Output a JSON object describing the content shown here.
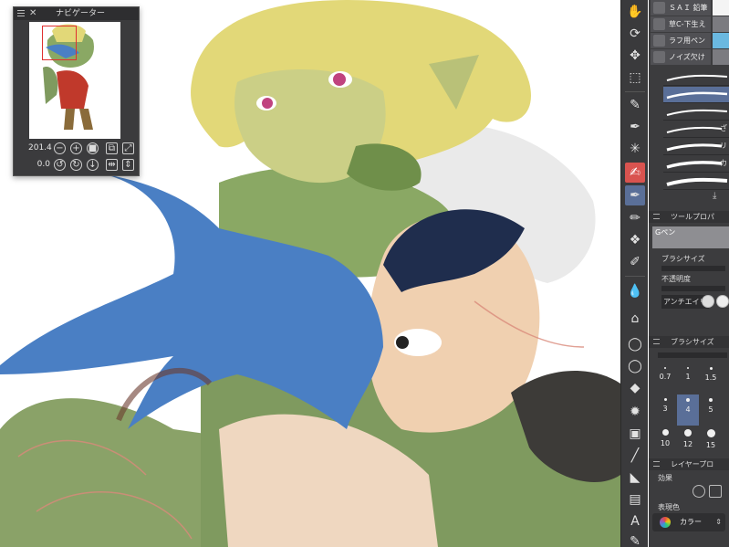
{
  "navigator": {
    "title": "ナビゲーター",
    "zoom": "201.4",
    "rotation": "0.0"
  },
  "sub_tools": {
    "items": [
      {
        "label": "ＳＡＩ 鉛筆"
      },
      {
        "label": "草C-下生え"
      },
      {
        "label": "ラフ用ペン"
      },
      {
        "label": "ノイズ欠け"
      }
    ]
  },
  "brush_strokes": {
    "labels": [
      "",
      "",
      "",
      "ざ",
      "リ",
      "カ",
      ""
    ]
  },
  "tool_property": {
    "title": "ツールプロパ",
    "brush_name": "Gペン",
    "brush_size_label": "ブラシサイズ",
    "opacity_label": "不透明度",
    "antialias_label": "アンチエイリ"
  },
  "brush_size_panel": {
    "title": "ブラシサイズ",
    "sizes": [
      "0.7",
      "1",
      "1.5",
      "3",
      "4",
      "5",
      "10",
      "12",
      "15"
    ],
    "selected": "4"
  },
  "layer_property": {
    "title": "レイヤープロ",
    "effect_label": "効果",
    "expression_color_label": "表現色",
    "color_value": "カラー"
  },
  "colors": {
    "toolbar_bg": "#3a3a3c",
    "panel_bg": "#3c3c3e",
    "selected": "#5a6f98",
    "accent_red": "#d9534f"
  },
  "toolbar_icons": [
    "hand-icon",
    "rotate-icon",
    "move-icon",
    "selection-icon",
    "eyedropper-icon",
    "pen-icon",
    "sparkle-icon",
    "brush-red-icon",
    "pen-active-icon",
    "marker-icon",
    "pattern-icon",
    "fill-pen-icon",
    "water-drop-icon",
    "house-icon",
    "speech-bubble-icon",
    "speech-bubble-2-icon",
    "eraser-icon",
    "blend-icon",
    "gradient-icon",
    "line-icon",
    "ruler-icon",
    "frame-icon",
    "text-icon",
    "correction-icon"
  ]
}
